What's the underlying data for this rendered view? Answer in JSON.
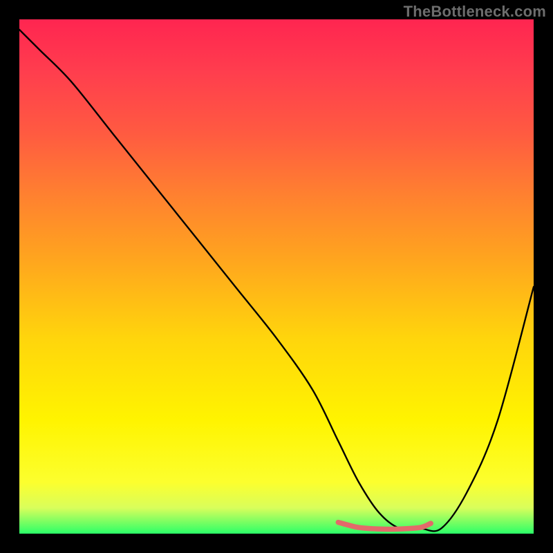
{
  "watermark": "TheBottleneck.com",
  "chart_data": {
    "type": "line",
    "title": "",
    "xlabel": "",
    "ylabel": "",
    "xlim": [
      0,
      100
    ],
    "ylim": [
      0,
      100
    ],
    "grid": false,
    "background_gradient": [
      "#ff2550",
      "#ffa31f",
      "#fff400",
      "#2bff68"
    ],
    "series": [
      {
        "name": "bottleneck-curve",
        "color": "#000000",
        "x": [
          0,
          4,
          10,
          18,
          26,
          34,
          42,
          50,
          57,
          62,
          66,
          70,
          74,
          78,
          82,
          87,
          93,
          100
        ],
        "y": [
          98,
          94,
          88,
          78,
          68,
          58,
          48,
          38,
          28,
          18,
          10,
          4,
          1,
          1,
          1,
          8,
          22,
          48
        ]
      },
      {
        "name": "optimal-range-marker",
        "color": "#e36a6a",
        "x": [
          62,
          66,
          70,
          74,
          78,
          80
        ],
        "y": [
          2.2,
          1.2,
          0.9,
          0.9,
          1.2,
          2.0
        ]
      }
    ]
  }
}
